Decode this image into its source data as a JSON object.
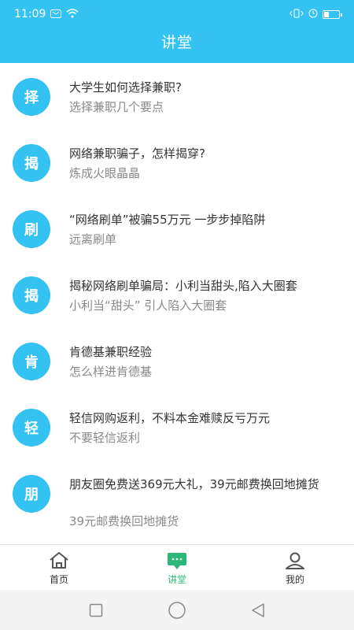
{
  "status_bar": {
    "time": "11:09"
  },
  "header": {
    "title": "讲堂"
  },
  "items": [
    {
      "avatar": "择",
      "title": "大学生如何选择兼职?",
      "subtitle": "选择兼职几个要点"
    },
    {
      "avatar": "揭",
      "title": "网络兼职骗子，怎样揭穿?",
      "subtitle": "炼成火眼晶晶"
    },
    {
      "avatar": "刷",
      "title": "“网络刷单”被骗55万元 一步步掉陷阱",
      "subtitle": "远离刷单"
    },
    {
      "avatar": "揭",
      "title": "揭秘网络刷单骗局：小利当甜头,陷入大圈套",
      "subtitle": "小利当“甜头” 引人陷入大圈套"
    },
    {
      "avatar": "肯",
      "title": "肯德基兼职经验",
      "subtitle": "怎么样进肯德基"
    },
    {
      "avatar": "轻",
      "title": "轻信网购返利，不料本金难赎反亏万元",
      "subtitle": "不要轻信返利"
    },
    {
      "avatar": "朋",
      "title": "朋友圈免费送369元大礼，39元邮费换回地摊货",
      "subtitle": "39元邮费换回地摊货"
    },
    {
      "avatar": "",
      "title": "",
      "subtitle": ""
    }
  ],
  "tabs": [
    {
      "label": "首页",
      "icon": "home-icon"
    },
    {
      "label": "讲堂",
      "icon": "chat-icon"
    },
    {
      "label": "我的",
      "icon": "profile-icon"
    }
  ],
  "colors": {
    "accent": "#33c2f2",
    "active_tab": "#2db87a"
  }
}
